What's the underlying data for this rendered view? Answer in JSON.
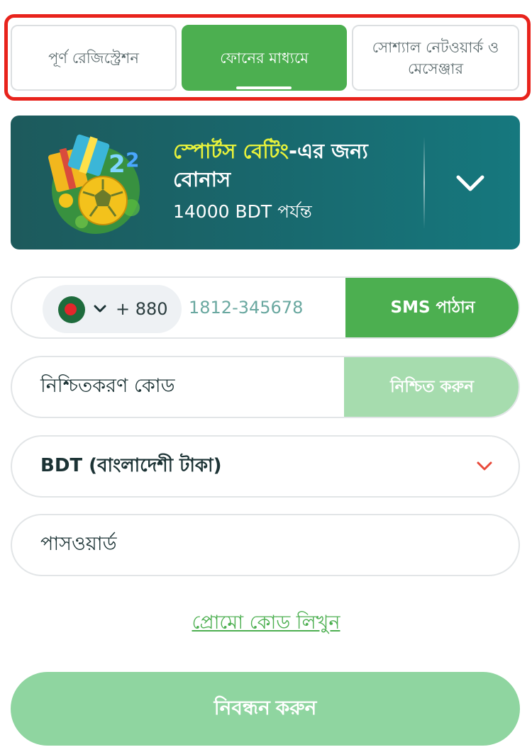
{
  "tabs": [
    {
      "label": "পূর্ণ রেজিস্ট্রেশন",
      "active": false
    },
    {
      "label": "ফোনের মাধ্যমে",
      "active": true
    },
    {
      "label": "সোশ্যাল নেটওয়ার্ক ও মেসেঞ্জার",
      "active": false
    }
  ],
  "bonus": {
    "title_accent": "স্পোর্টস বেটিং",
    "title_rest": "-এর জন্য বোনাস",
    "amount": "14000 BDT পর্যন্ত",
    "icons": [
      "gift-box-icon",
      "football-icon",
      "chevron-down-icon"
    ]
  },
  "phone": {
    "country_code": "+ 880",
    "placeholder": "1812-345678",
    "send_label": "SMS পাঠান",
    "flag": "bangladesh-flag-icon"
  },
  "confirmation": {
    "placeholder": "নিশ্চিতকরণ কোড",
    "confirm_label": "নিশ্চিত করুন"
  },
  "currency": {
    "selected": "BDT (বাংলাদেশী টাকা)"
  },
  "password": {
    "placeholder": "পাসওয়ার্ড"
  },
  "promo_link": "প্রোমো কোড লিখুন",
  "register_label": "নিবন্ধন করুন",
  "colors": {
    "brand_green": "#4caf50",
    "light_green": "#8fd5a0",
    "banner_teal": "#19666b",
    "accent_yellow": "#e7f23b",
    "highlight_red": "#e8231c",
    "chevron_red": "#e8493a"
  }
}
